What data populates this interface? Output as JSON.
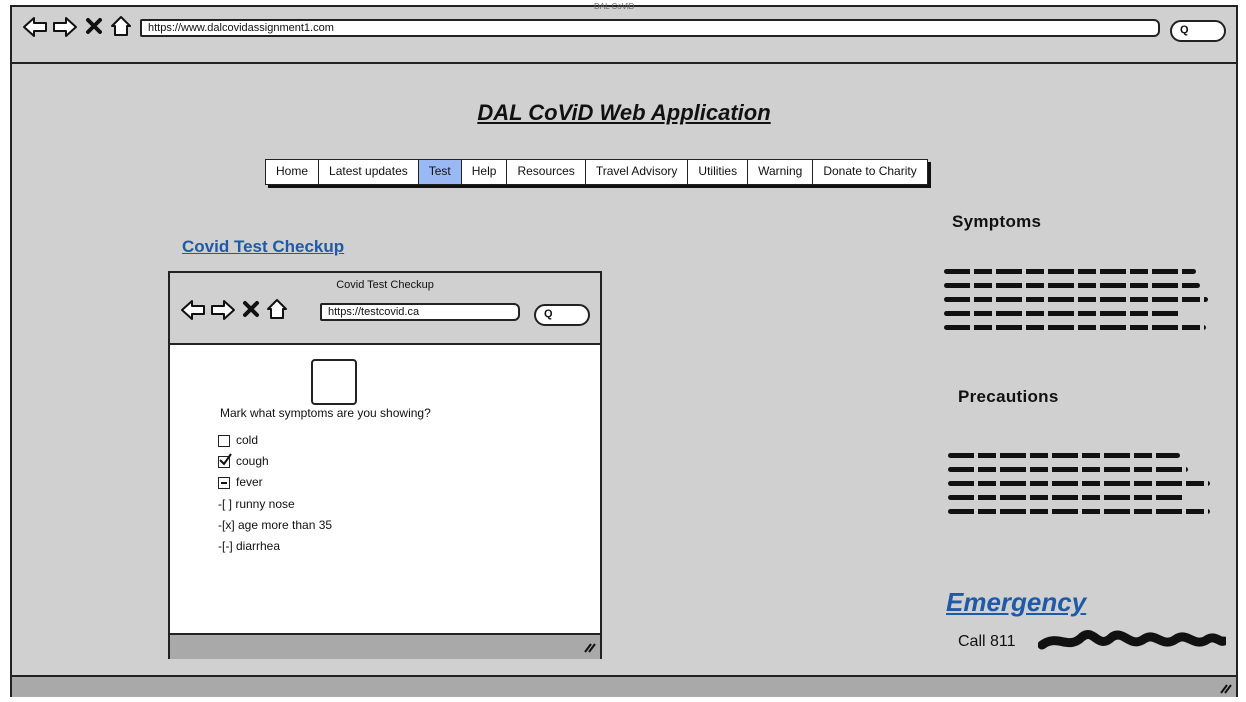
{
  "outer_browser": {
    "window_title": "DAL CoViD",
    "url": "https://www.dalcovidassignment1.com"
  },
  "page": {
    "title": "DAL CoViD Web Application"
  },
  "nav": {
    "items": [
      {
        "label": "Home"
      },
      {
        "label": "Latest updates"
      },
      {
        "label": "Test",
        "active": true
      },
      {
        "label": "Help"
      },
      {
        "label": "Resources"
      },
      {
        "label": "Travel Advisory"
      },
      {
        "label": "Utilities"
      },
      {
        "label": "Warning"
      },
      {
        "label": "Donate to Charity"
      }
    ],
    "active_color": "#9ab9f4"
  },
  "section": {
    "heading": "Covid Test Checkup"
  },
  "inner_browser": {
    "window_title": "Covid Test Checkup",
    "url": "https://testcovid.ca",
    "question": "Mark what symptoms are you showing?",
    "checkboxes": [
      {
        "label": "cold",
        "state": "unchecked"
      },
      {
        "label": "cough",
        "state": "checked"
      },
      {
        "label": "fever",
        "state": "indeterminate"
      }
    ],
    "text_options": [
      "-[ ] runny nose",
      "-[x] age more than 35",
      "-[-] diarrhea"
    ]
  },
  "sidebar": {
    "symptoms_heading": "Symptoms",
    "precautions_heading": "Precautions",
    "emergency_heading": "Emergency",
    "call_text": "Call 811"
  },
  "colors": {
    "link": "#1e5aa8",
    "chrome": "#d0d0d0",
    "status": "#a9a9a9"
  }
}
